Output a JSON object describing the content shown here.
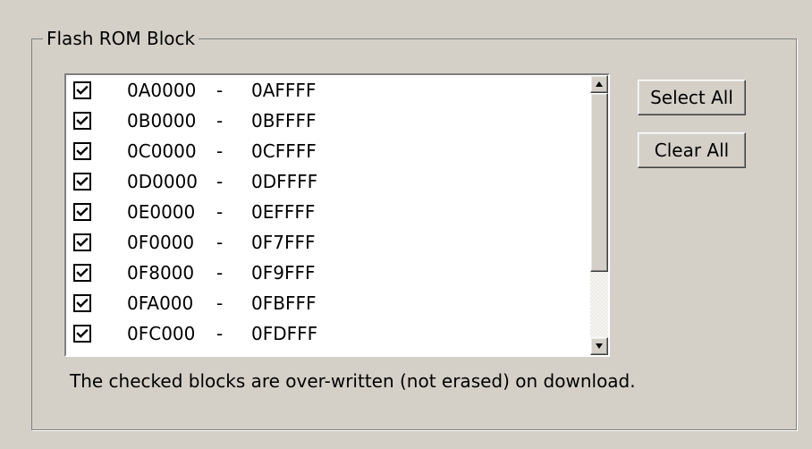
{
  "group": {
    "title": "Flash ROM Block"
  },
  "flash_blocks": [
    {
      "checked": true,
      "start": "0A0000",
      "separator": "-",
      "end": "0AFFFF"
    },
    {
      "checked": true,
      "start": "0B0000",
      "separator": "-",
      "end": "0BFFFF"
    },
    {
      "checked": true,
      "start": "0C0000",
      "separator": "-",
      "end": "0CFFFF"
    },
    {
      "checked": true,
      "start": "0D0000",
      "separator": "-",
      "end": "0DFFFF"
    },
    {
      "checked": true,
      "start": "0E0000",
      "separator": "-",
      "end": "0EFFFF"
    },
    {
      "checked": true,
      "start": "0F0000",
      "separator": "-",
      "end": "0F7FFF"
    },
    {
      "checked": true,
      "start": "0F8000",
      "separator": "-",
      "end": "0F9FFF"
    },
    {
      "checked": true,
      "start": "0FA000",
      "separator": "-",
      "end": "0FBFFF"
    },
    {
      "checked": true,
      "start": "0FC000",
      "separator": "-",
      "end": "0FDFFF"
    }
  ],
  "buttons": {
    "select_all": "Select All",
    "clear_all": "Clear All"
  },
  "note": "The checked blocks are over-written (not erased) on download.",
  "icons": {
    "checkbox": "check-icon",
    "scroll_up": "up-arrow-icon",
    "scroll_down": "down-arrow-icon"
  }
}
